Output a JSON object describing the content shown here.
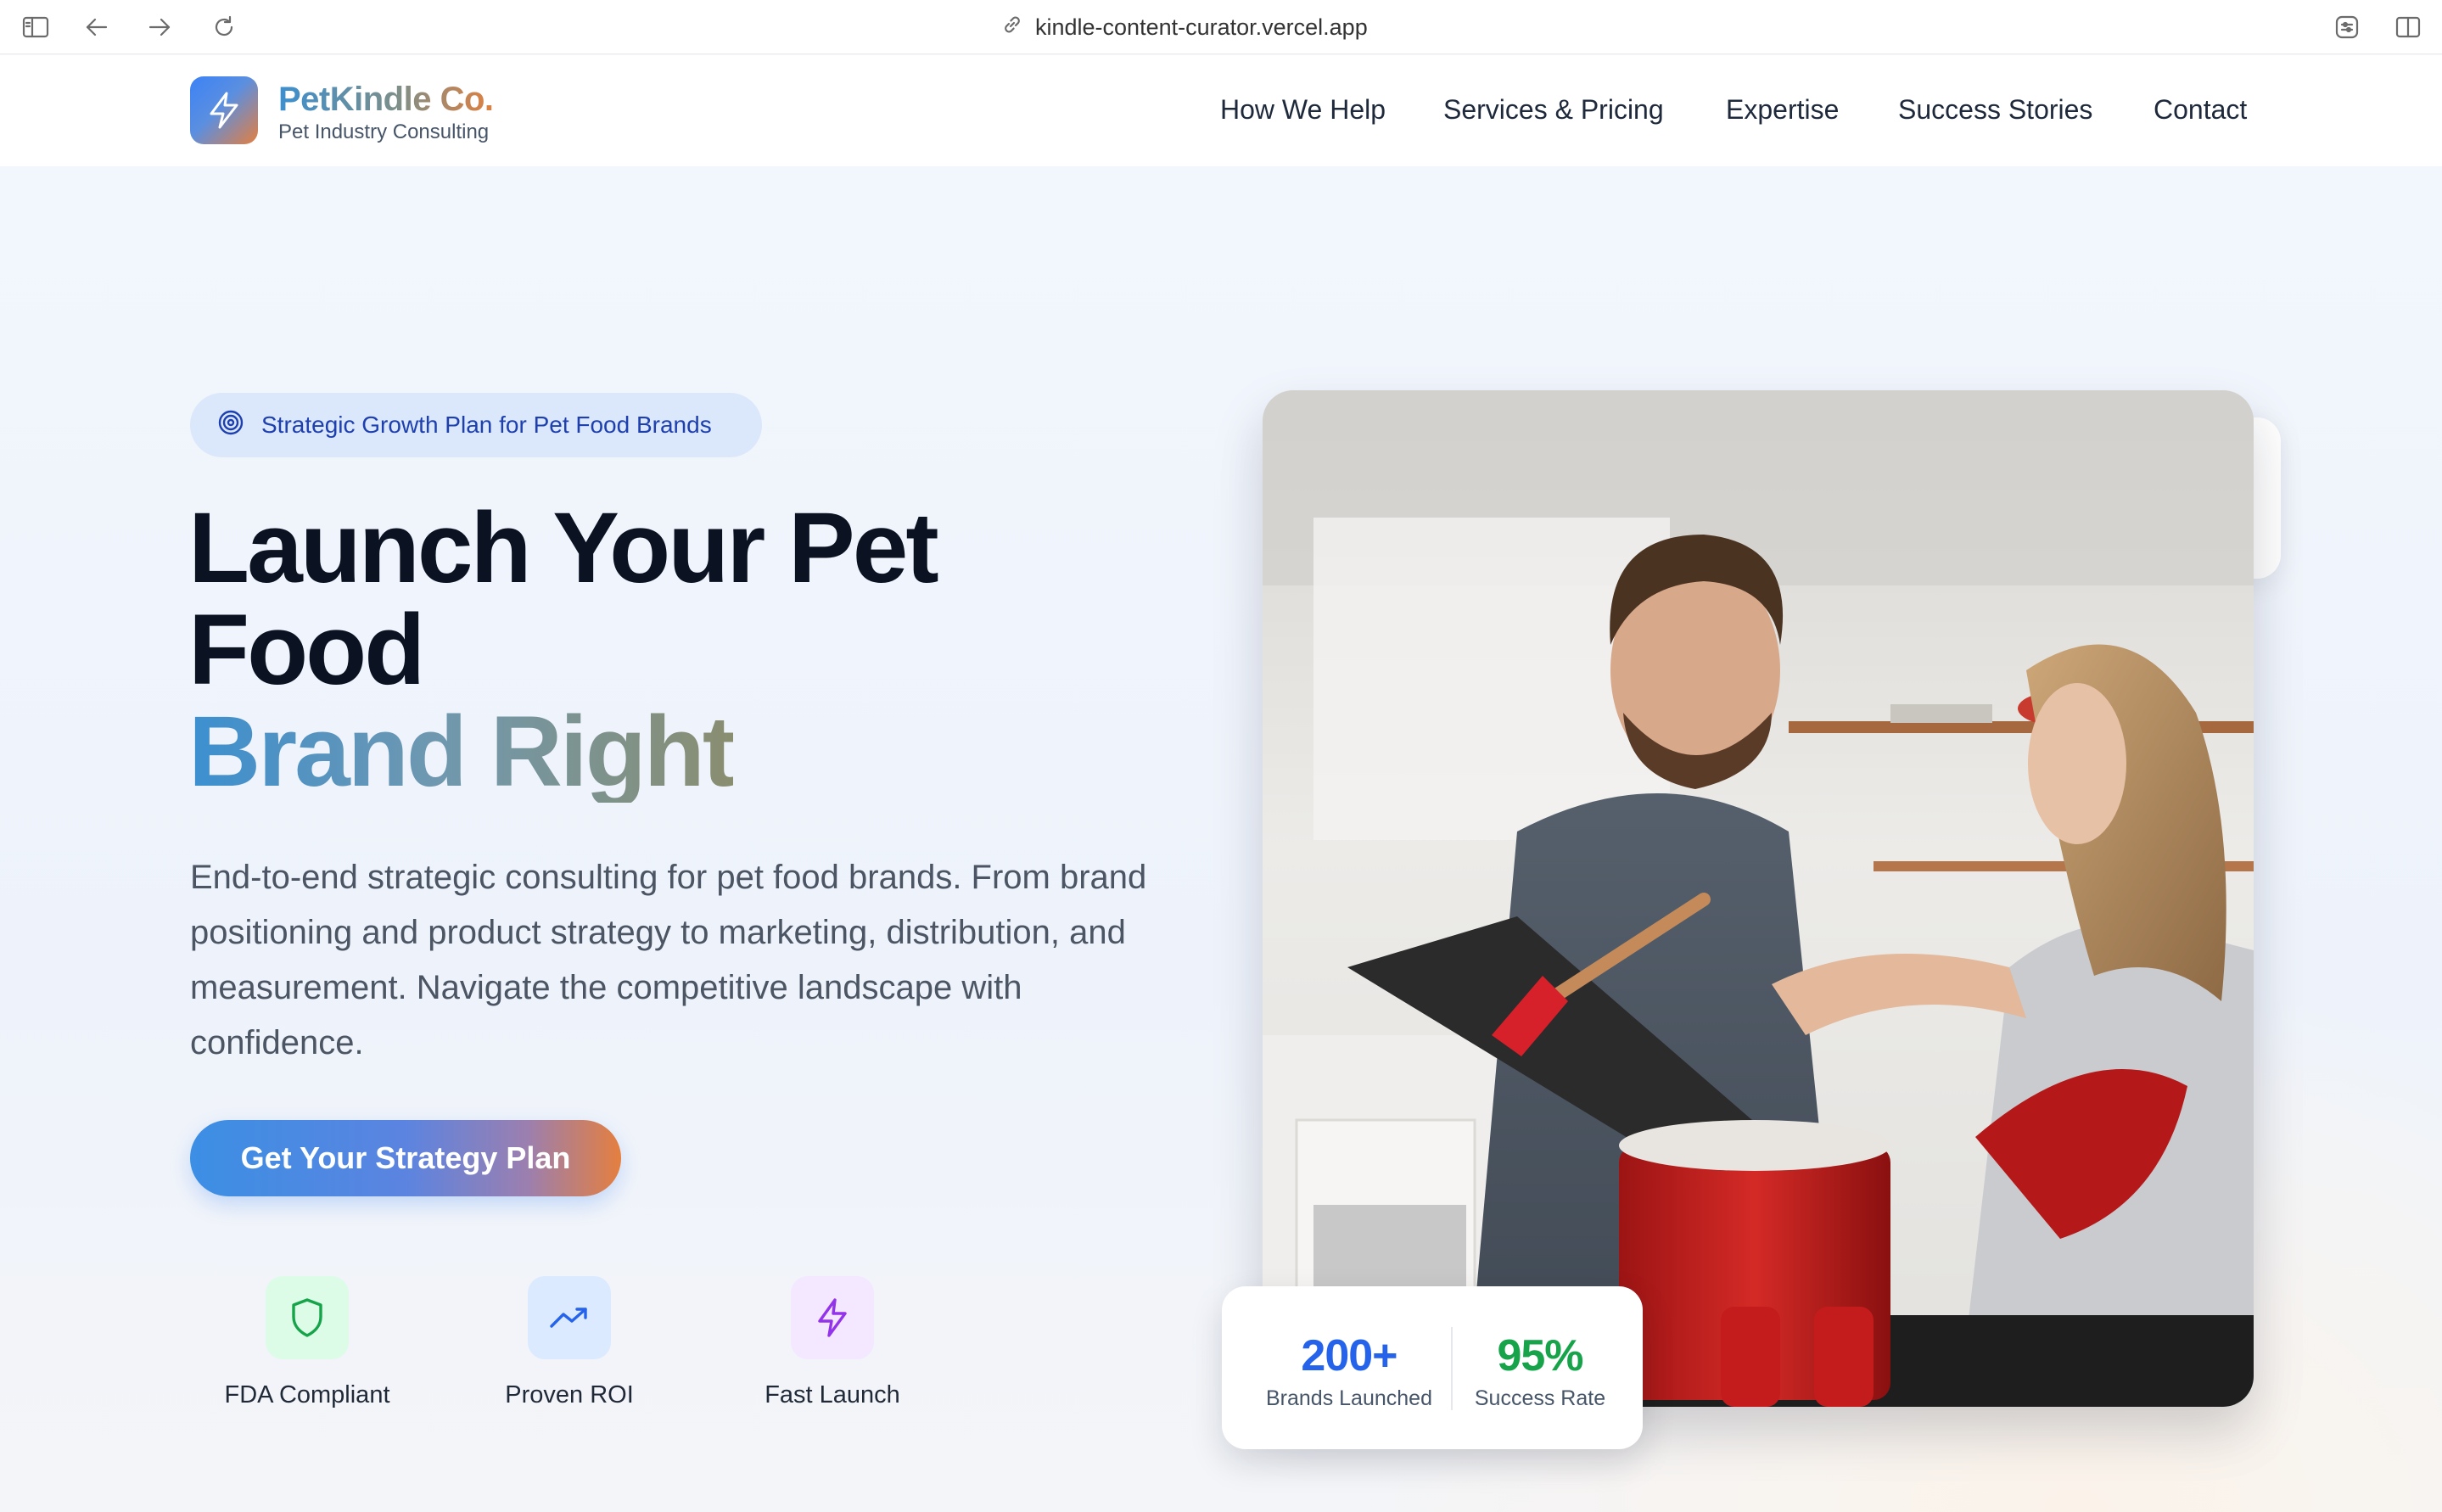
{
  "browser": {
    "url": "kindle-content-curator.vercel.app"
  },
  "header": {
    "brand_name": "PetKindle Co.",
    "brand_tagline": "Pet Industry Consulting",
    "nav": [
      {
        "label": "How We Help"
      },
      {
        "label": "Services & Pricing"
      },
      {
        "label": "Expertise"
      },
      {
        "label": "Success Stories"
      },
      {
        "label": "Contact"
      }
    ]
  },
  "hero": {
    "badge": "Strategic Growth Plan for Pet Food Brands",
    "headline_line1": "Launch Your Pet",
    "headline_line2": "Food",
    "headline_accent": "Brand Right",
    "description": "End-to-end strategic consulting for pet food brands. From brand positioning and product strategy to marketing, distribution, and measurement. Navigate the competitive landscape with confidence.",
    "cta_label": "Get Your Strategy Plan",
    "features": [
      {
        "label": "FDA Compliant",
        "icon": "shield-icon",
        "bg": "#dcfce7",
        "color": "#16a34a"
      },
      {
        "label": "Proven ROI",
        "icon": "trending-up-icon",
        "bg": "#dbeafe",
        "color": "#2563eb"
      },
      {
        "label": "Fast Launch",
        "icon": "lightning-icon",
        "bg": "#f3e8ff",
        "color": "#9333ea"
      }
    ]
  },
  "stats": [
    {
      "value": "200+",
      "label": "Brands Launched",
      "color": "#2563eb"
    },
    {
      "value": "95%",
      "label": "Success Rate",
      "color": "#16a34a"
    }
  ],
  "colors": {
    "brand_blue": "#3b8fd0",
    "brand_orange": "#e0803f"
  }
}
